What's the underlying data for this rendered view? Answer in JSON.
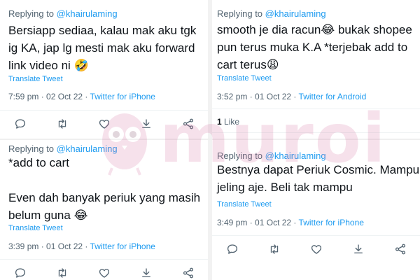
{
  "colors": {
    "link_blue": "#1d9bf0",
    "secondary_gray": "#536471",
    "text_black": "#0f1419",
    "watermark_pink": "#d77aa6"
  },
  "tweets": [
    {
      "replying_prefix": "Replying to",
      "handle": "@khairulaming",
      "text": "Bersiapp sediaa, kalau mak aku tgk ig KA, jap lg mesti mak aku forward link video ni 🤣",
      "translate": "Translate Tweet",
      "time": "7:59 pm",
      "date": "02 Oct 22",
      "source": "Twitter for iPhone"
    },
    {
      "replying_prefix": "Replying to",
      "handle": "@khairulaming",
      "text": "smooth je dia racun😂 bukak shopee pun terus muka K.A *terjebak add to cart terus😩",
      "translate": "Translate Tweet",
      "time": "3:52 pm",
      "date": "01 Oct 22",
      "source": "Twitter for Android",
      "likes_count": "1",
      "likes_label": "Like"
    },
    {
      "replying_prefix": "Replying to",
      "handle": "@khairulaming",
      "text": "*add to cart\n\nEven dah banyak periuk yang masih belum guna 😂",
      "translate": "Translate Tweet",
      "time": "3:39 pm",
      "date": "01 Oct 22",
      "source": "Twitter for iPhone"
    },
    {
      "replying_prefix": "Replying to",
      "handle": "@khairulaming",
      "text": "Bestnya dapat Periuk Cosmic. Mampu jeling aje. Beli tak mampu",
      "translate": "Translate Tweet",
      "time": "3:49 pm",
      "date": "01 Oct 22",
      "source": "Twitter for iPhone"
    }
  ],
  "separator": "·",
  "icons": [
    "reply-icon",
    "retweet-icon",
    "like-icon",
    "download-icon",
    "share-icon"
  ],
  "watermark": {
    "text": "muroi",
    "logo": "owl-logo-icon"
  }
}
